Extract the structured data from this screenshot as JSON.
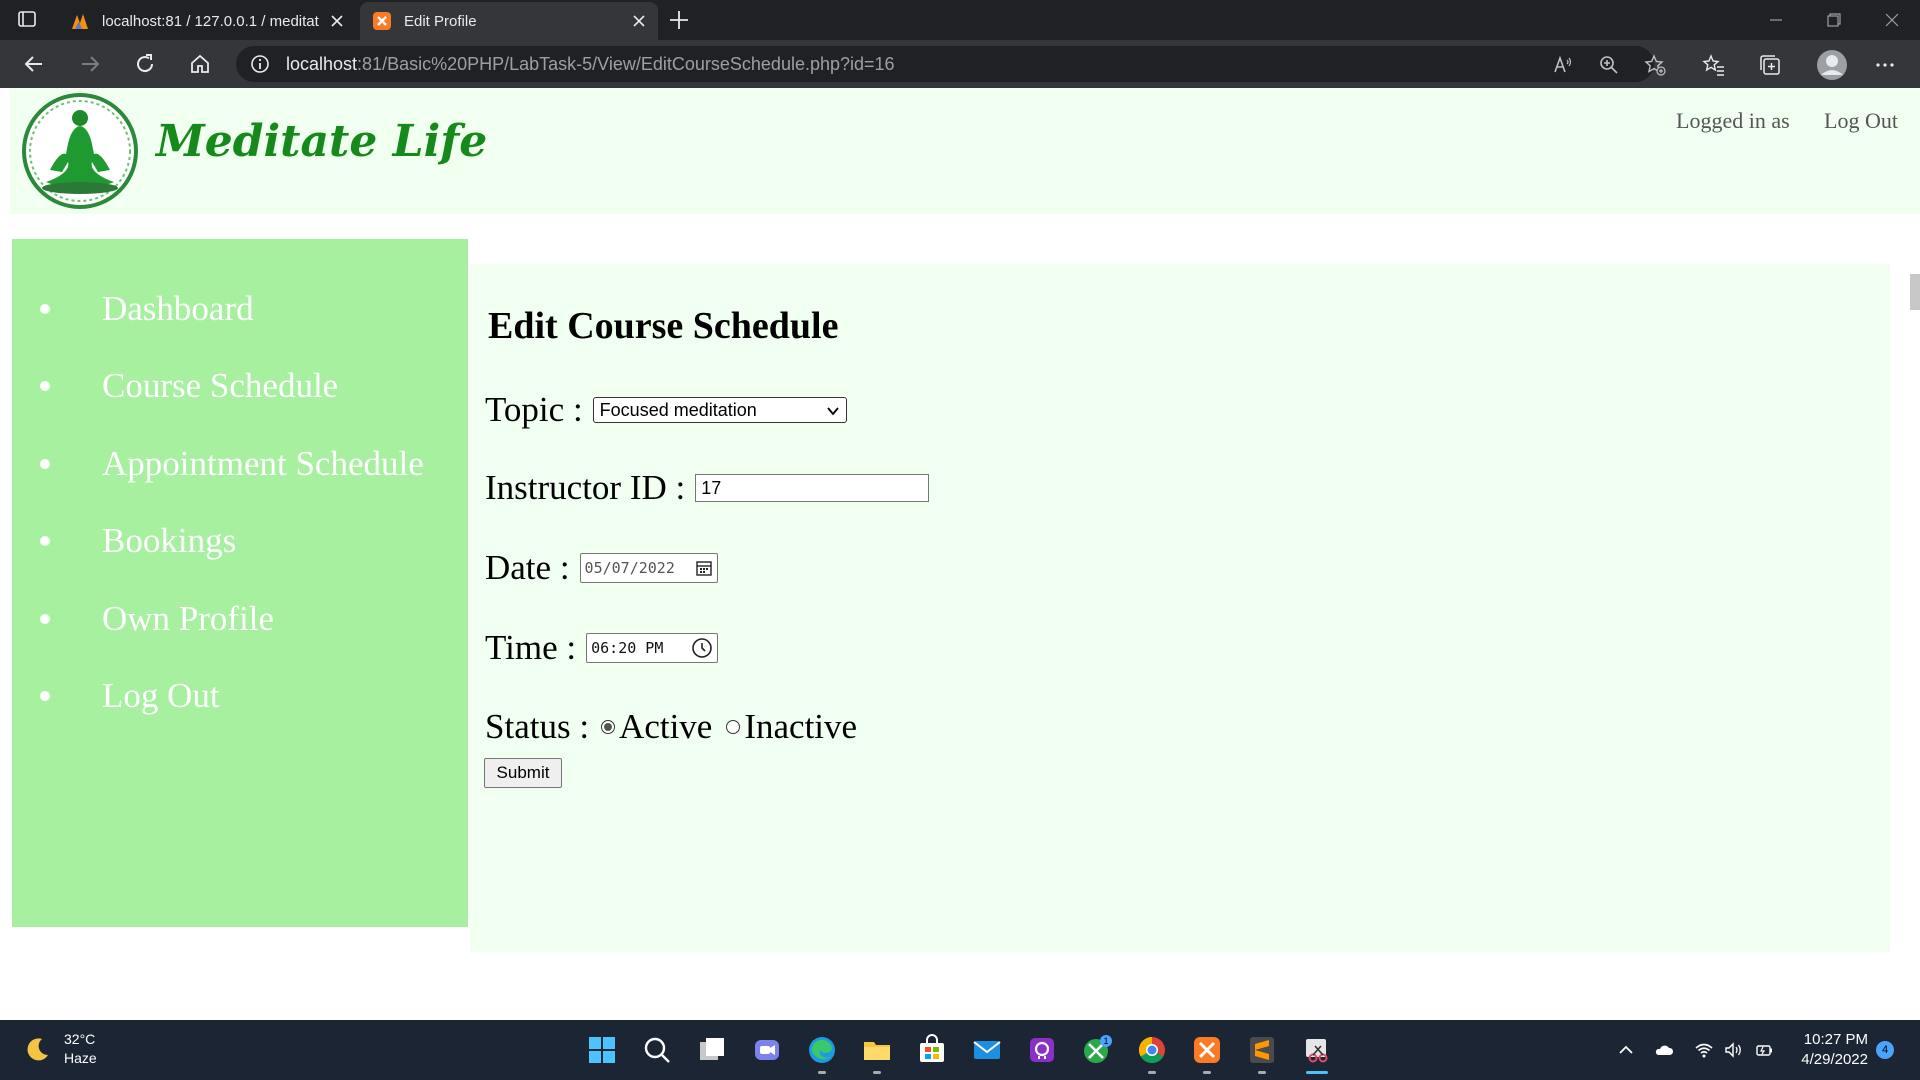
{
  "browser": {
    "tabs": [
      {
        "label": "localhost:81 / 127.0.0.1 / meditat",
        "active": false
      },
      {
        "label": "Edit Profile",
        "active": true
      }
    ],
    "url_host": "localhost",
    "url_rest": ":81/Basic%20PHP/LabTask-5/View/EditCourseSchedule.php?id=16"
  },
  "header": {
    "brand": "Meditate Life",
    "logged_in_label": "Logged in as",
    "logout_label": "Log Out"
  },
  "sidebar": {
    "items": [
      {
        "label": "Dashboard"
      },
      {
        "label": "Course Schedule"
      },
      {
        "label": "Appointment Schedule"
      },
      {
        "label": "Bookings"
      },
      {
        "label": "Own Profile"
      },
      {
        "label": "Log Out"
      }
    ]
  },
  "form": {
    "title": "Edit Course Schedule",
    "topic_label": "Topic :",
    "topic_value": "Focused meditation",
    "instructor_label": "Instructor ID :",
    "instructor_value": "17",
    "date_label": "Date :",
    "date_value": "05/07/2022",
    "time_label": "Time :",
    "time_value": "06:20 PM",
    "status_label": "Status :",
    "status_options": [
      {
        "label": "Active",
        "checked": true
      },
      {
        "label": "Inactive",
        "checked": false
      }
    ],
    "submit_label": "Submit"
  },
  "taskbar": {
    "temperature": "32°C",
    "condition": "Haze",
    "time": "10:27 PM",
    "date": "4/29/2022",
    "notification_count": "4",
    "xbox_badge": "1"
  },
  "colors": {
    "sidebar_bg": "#a6f0a0",
    "content_bg": "#f0fff0",
    "brand_green": "#158a1a"
  }
}
